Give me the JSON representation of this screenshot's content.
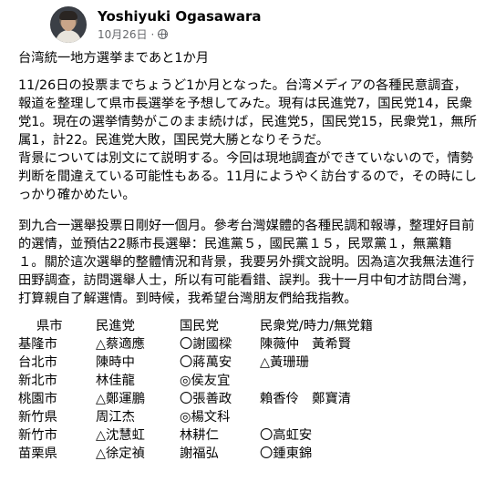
{
  "post": {
    "author": "Yoshiyuki Ogasawara",
    "date": "10月26日",
    "dot": "·",
    "title": "台湾統一地方選挙まであと1か月",
    "para_jp_1": "11/26日の投票までちょうど1か月となった。台湾メディアの各種民意調査，報道を整理して県市長選挙を予想してみた。現有は民進党7，国民党14，民衆党1。現在の選挙情勢がこのまま続けば，民進党5，国民党15，民衆党1，無所属1，計22。民進党大敗，国民党大勝となりそうだ。",
    "para_jp_2": "背景については別文にて説明する。今回は現地調査ができていないので，情勢判断を間違えている可能性もある。11月にようやく訪台するので，その時にしっかり確かめたい。",
    "para_zh": "到九合一選舉投票日剛好一個月。參考台灣媒體的各種民調和報導，整理好目前的選情，並預估22縣市長選舉：民進黨５，國民黨１５，民眾黨１，無黨籍１。關於這次選舉的整體情況和背景，我要另外撰文說明。因為這次我無法進行田野調查，訪問選舉人士，所以有可能看錯、誤判。我十一月中旬才訪問台灣，打算親自了解選情。到時候，我希望台灣朋友們給我指教。"
  },
  "table": {
    "headers": [
      "県市",
      "民進党",
      "国民党",
      "民衆党/時力/無党籍"
    ],
    "rows": [
      [
        "基隆市",
        "△蔡適應",
        "〇謝國樑",
        "陳薇仲　黃希賢"
      ],
      [
        "台北市",
        "陳時中",
        "〇蔣萬安",
        "△黃珊珊"
      ],
      [
        "新北市",
        "林佳龍",
        "◎侯友宜",
        ""
      ],
      [
        "桃園市",
        "△鄭運鵬",
        "〇張善政",
        "賴香伶　鄭寶清"
      ],
      [
        "新竹県",
        "周江杰",
        "◎楊文科",
        ""
      ],
      [
        "新竹市",
        "△沈慧虹",
        "林耕仁",
        "〇高虹安"
      ],
      [
        "苗栗県",
        "△徐定禎",
        "謝福弘",
        "〇鍾東錦"
      ]
    ]
  }
}
